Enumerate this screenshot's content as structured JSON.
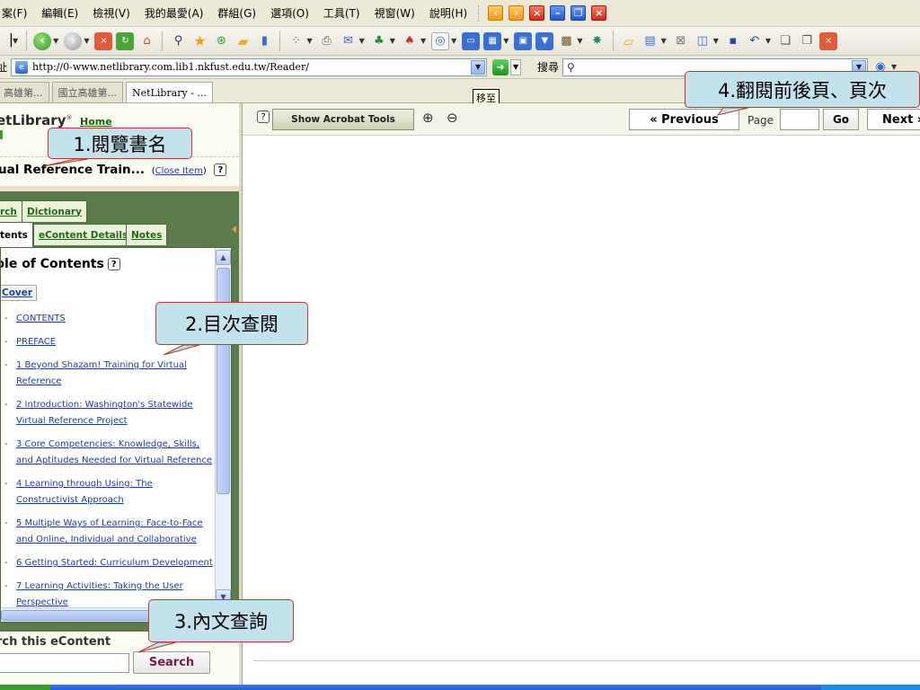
{
  "menubar": {
    "items": [
      "案(F)",
      "編輯(E)",
      "檢視(V)",
      "我的最愛(A)",
      "群組(G)",
      "選項(O)",
      "工具(T)",
      "視窗(W)",
      "說明(H)"
    ]
  },
  "address": {
    "label": "址",
    "url": "http://0-www.netlibrary.com.lib1.nkfust.edu.tw/Reader/"
  },
  "search": {
    "label": "搜尋"
  },
  "tabs": [
    {
      "label": "高雄第..."
    },
    {
      "label": "國立高雄第..."
    },
    {
      "label": "NetLibrary - ..."
    }
  ],
  "tooltip": "移至",
  "left_panel": {
    "logo": "etLibrary",
    "logo_tm": "®",
    "home_link": "Home",
    "book_title": "ual Reference Train...",
    "close_item": "Close Item",
    "tabs_top": [
      "rch",
      "Dictionary"
    ],
    "tabs_bottom": [
      "tents",
      "eContent Details",
      "Notes"
    ],
    "toc_title": "ble of Contents",
    "cover": "Cover",
    "toc_items": [
      "CONTENTS",
      "PREFACE",
      "1 Beyond Shazam! Training for Virtual Reference",
      "2 Introduction: Washington's Statewide Virtual Reference Project",
      "3 Core Competencies: Knowledge, Skills, and Aptitudes Needed for Virtual Reference",
      "4 Learning through Using: The Constructivist Approach",
      "5 Multiple Ways of Learning: Face-to-Face and Online, Individual and Collaborative",
      "6 Getting Started: Curriculum Development",
      "7 Learning Activities: Taking the User Perspective"
    ],
    "search_label": "rch this eContent",
    "search_button": "Search"
  },
  "reader": {
    "acrobat_button": "Show Acrobat Tools",
    "previous": "« Previous",
    "page_label": "Page",
    "go": "Go",
    "next": "Next »"
  },
  "callouts": {
    "c1": "1.閱覽書名",
    "c2": "2.目次查閱",
    "c3": "3.內文查詢",
    "c4": "4.翻閱前後頁、頁次"
  },
  "colors": {
    "callout_fill": "#c4e2ec",
    "callout_border": "#c0392b",
    "panel_green": "#5c7a4a",
    "link_blue": "#1b3fa8"
  }
}
